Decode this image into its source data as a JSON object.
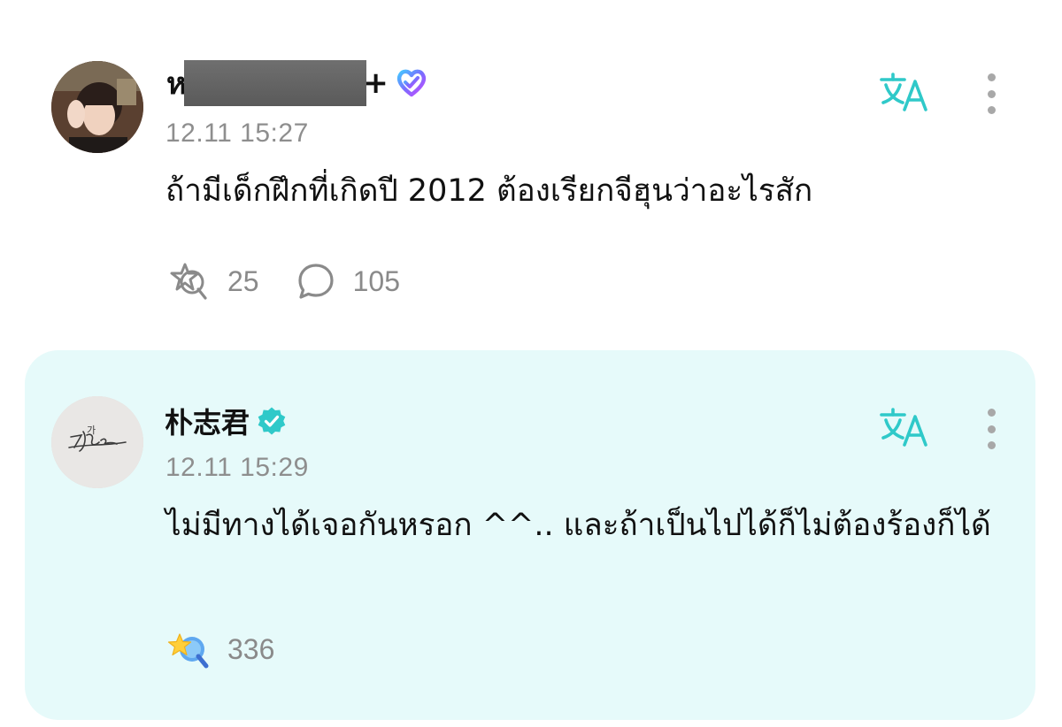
{
  "post": {
    "author_name_lead": "ห",
    "author_name_trail": "+",
    "timestamp": "12.11 15:27",
    "text": "ถ้ามีเด็กฝึกที่เกิดปี 2012 ต้องเรียกจีฮุนว่าอะไรสัก",
    "like_count": "25",
    "comment_count": "105"
  },
  "reply": {
    "author_name": "朴志君",
    "timestamp": "12.11 15:29",
    "text": "ไม่มีทางได้เจอกันหรอก ^^.. และถ้าเป็นไปได้ก็ไม่ต้องร้องก็ได้",
    "like_count": "336",
    "avatar_signature": "가"
  },
  "icons": {
    "translate": "translate-icon",
    "more": "more-vertical-icon",
    "like": "like-sticker-icon",
    "comment": "comment-bubble-icon",
    "verified_gradient": "verified-gradient-badge-icon",
    "verified_check": "verified-check-badge-icon"
  },
  "colors": {
    "accent_teal": "#2fc9c9",
    "reply_background": "#e6fafa",
    "meta_gray": "#8e8e8e"
  }
}
